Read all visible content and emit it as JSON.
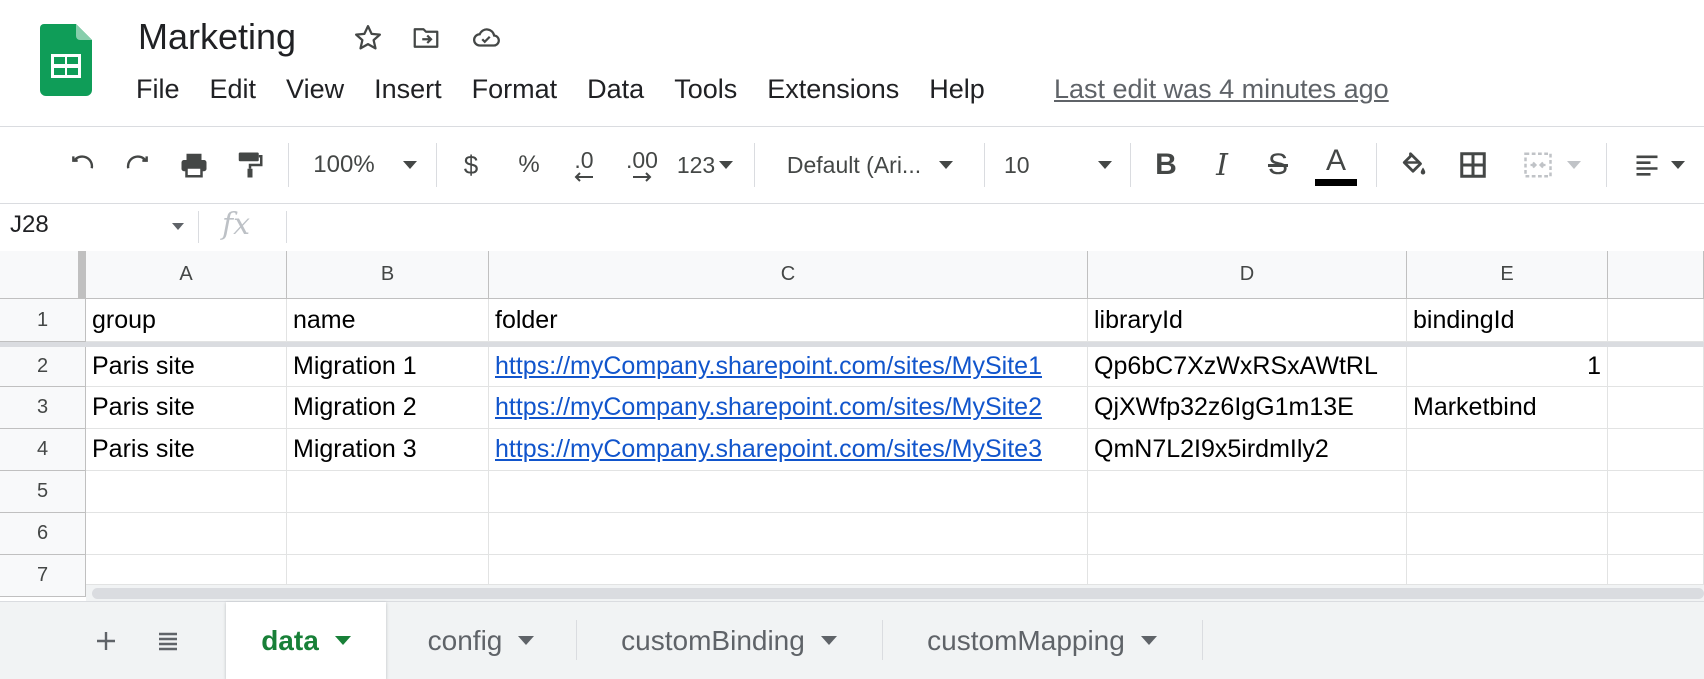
{
  "app": {
    "title": "Marketing",
    "last_edit": "Last edit was 4 minutes ago",
    "title_icons": [
      "star-icon",
      "move-to-folder-icon",
      "cloud-saved-icon"
    ]
  },
  "menu": [
    "File",
    "Edit",
    "View",
    "Insert",
    "Format",
    "Data",
    "Tools",
    "Extensions",
    "Help"
  ],
  "toolbar": {
    "zoom": "100%",
    "currency": "$",
    "percent": "%",
    "decrease_decimal": ".0",
    "increase_decimal": ".00",
    "more_formats": "123",
    "font": "Default (Ari...",
    "font_size": "10",
    "text_color": "#000000"
  },
  "formula_bar": {
    "name_box": "J28",
    "fx": "fx",
    "value": ""
  },
  "sheet": {
    "columns": [
      "A",
      "B",
      "C",
      "D",
      "E"
    ],
    "row_numbers": [
      "1",
      "2",
      "3",
      "4",
      "5",
      "6",
      "7"
    ],
    "rows": [
      [
        "group",
        "name",
        "folder",
        "libraryId",
        "bindingId"
      ],
      [
        "Paris site",
        "Migration 1",
        "https://myCompany.sharepoint.com/sites/MySite1",
        "Qp6bC7XzWxRSxAWtRL",
        "1"
      ],
      [
        "Paris site",
        "Migration 2",
        "https://myCompany.sharepoint.com/sites/MySite2",
        "QjXWfp32z6IgG1m13E",
        "Marketbind"
      ],
      [
        "Paris site",
        "Migration 3",
        "https://myCompany.sharepoint.com/sites/MySite3",
        "QmN7L2I9x5irdmIly2",
        ""
      ],
      [
        "",
        "",
        "",
        "",
        ""
      ],
      [
        "",
        "",
        "",
        "",
        ""
      ],
      [
        "",
        "",
        "",
        "",
        ""
      ]
    ]
  },
  "tabs": [
    {
      "label": "data",
      "active": true
    },
    {
      "label": "config",
      "active": false
    },
    {
      "label": "customBinding",
      "active": false
    },
    {
      "label": "customMapping",
      "active": false
    }
  ],
  "colors": {
    "brand_green": "#0f9d58",
    "active_tab": "#188038",
    "link": "#1155cc"
  }
}
